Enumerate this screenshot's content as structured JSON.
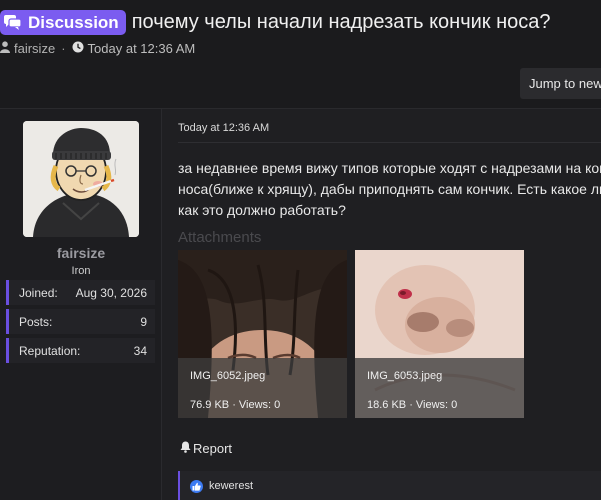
{
  "thread": {
    "prefix": "Discussion",
    "title": "почему челы начали надрезать кончик носа?",
    "author": "fairsize",
    "date": "Today at 12:36 AM"
  },
  "jump_button": "Jump to new",
  "post": {
    "user": {
      "name": "fairsize",
      "title": "Iron",
      "stats": [
        {
          "label": "Joined:",
          "value": "Aug 30, 2026"
        },
        {
          "label": "Posts:",
          "value": "9"
        },
        {
          "label": "Reputation:",
          "value": "34"
        }
      ]
    },
    "date": "Today at 12:36 AM",
    "body_lines": [
      "за недавнее время вижу типов которые ходят с надрезами на кон",
      "носа(ближе к хрящу), дабы приподнять сам кончик. Есть какое ли",
      "как это должно работать?"
    ],
    "attachments_title": "Attachments",
    "attachments": [
      {
        "name": "IMG_6052.jpeg",
        "meta": "76.9 KB · Views: 0"
      },
      {
        "name": "IMG_6053.jpeg",
        "meta": "18.6 KB · Views: 0"
      }
    ],
    "report_label": "Report",
    "reaction_user": "kewerest"
  },
  "icons": {
    "prefix": "chat-bubbles-icon",
    "author": "user-icon",
    "date": "clock-icon",
    "report": "bell-icon",
    "reaction": "thumbs-up-icon"
  },
  "colors": {
    "accent": "#7b5cf0",
    "background": "#1b1b1d",
    "like": "#3d7bf2"
  }
}
